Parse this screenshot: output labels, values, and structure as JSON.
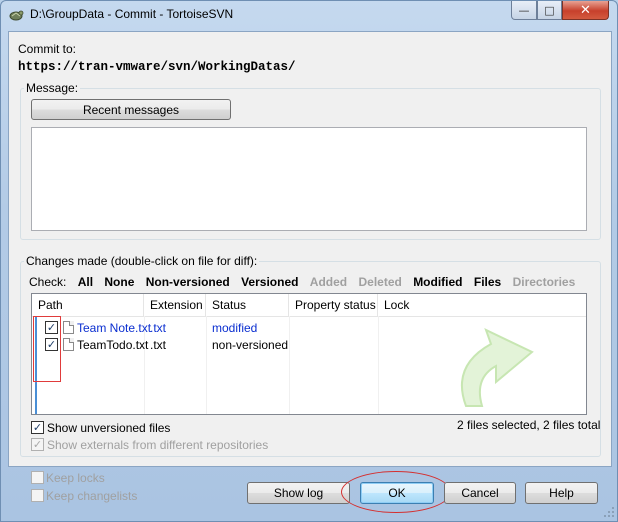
{
  "window": {
    "title": "D:\\GroupData - Commit - TortoiseSVN",
    "minimize_label": "—",
    "maximize_label": "□",
    "close_label": "✕"
  },
  "commit": {
    "label": "Commit to:",
    "url": "https://tran-vmware/svn/WorkingDatas/"
  },
  "message": {
    "group_label": "Message:",
    "recent_button": "Recent messages",
    "text": ""
  },
  "changes": {
    "group_label": "Changes made (double-click on file for diff):",
    "check_label": "Check:",
    "filters": [
      {
        "label": "All",
        "enabled": true
      },
      {
        "label": "None",
        "enabled": true
      },
      {
        "label": "Non-versioned",
        "enabled": true
      },
      {
        "label": "Versioned",
        "enabled": true
      },
      {
        "label": "Added",
        "enabled": false
      },
      {
        "label": "Deleted",
        "enabled": false
      },
      {
        "label": "Modified",
        "enabled": true
      },
      {
        "label": "Files",
        "enabled": true
      },
      {
        "label": "Directories",
        "enabled": false
      }
    ],
    "columns": [
      "Path",
      "Extension",
      "Status",
      "Property status",
      "Lock"
    ],
    "rows": [
      {
        "checked": true,
        "path": "Team Note.txt",
        "extension": ".txt",
        "status": "modified",
        "property_status": "",
        "lock": "",
        "icon": "text-file-icon"
      },
      {
        "checked": true,
        "path": "TeamTodo.txt",
        "extension": ".txt",
        "status": "non-versioned",
        "property_status": "",
        "lock": "",
        "icon": "text-file-icon"
      }
    ],
    "show_unversioned": {
      "label": "Show unversioned files",
      "checked": true
    },
    "show_externals": {
      "label": "Show externals from different repositories",
      "checked": true,
      "enabled": false
    },
    "selection_summary": "2 files selected, 2 files total"
  },
  "options": {
    "keep_locks": {
      "label": "Keep locks",
      "checked": false,
      "enabled": false
    },
    "keep_changelists": {
      "label": "Keep changelists",
      "checked": false,
      "enabled": false
    }
  },
  "buttons": {
    "show_log": "Show log",
    "ok": "OK",
    "cancel": "Cancel",
    "help": "Help"
  },
  "colors": {
    "link_blue": "#0a2ed0",
    "annotation_red": "#e03b3b",
    "watermark_green": "#7fd05a"
  }
}
